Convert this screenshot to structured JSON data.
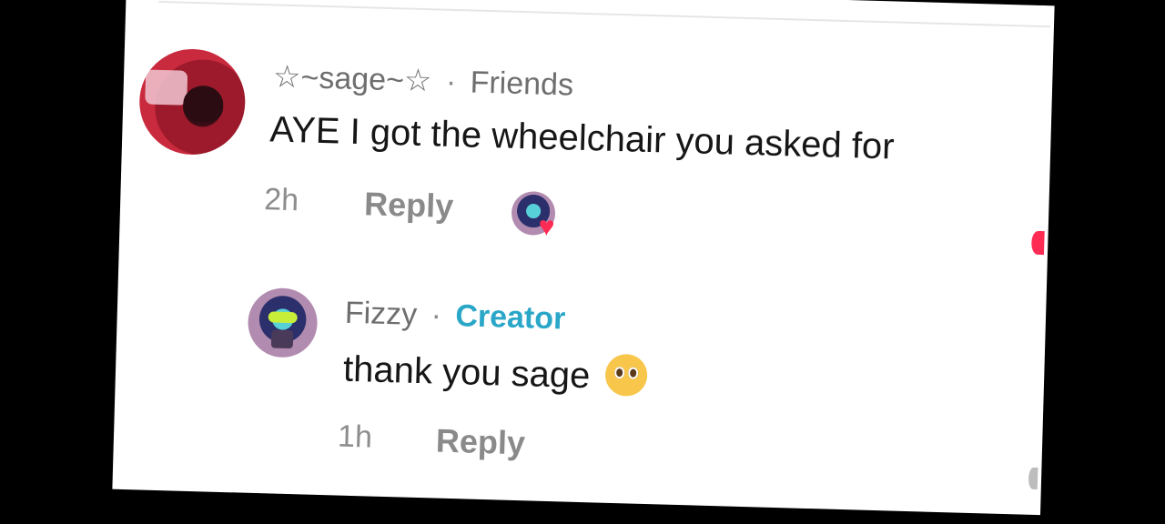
{
  "comments": [
    {
      "author": "☆~sage~☆",
      "relation": "Friends",
      "text": "AYE I got the wheelchair you asked for",
      "time": "2h",
      "reply_label": "Reply"
    },
    {
      "author": "Fizzy",
      "relation": "Creator",
      "text": "thank you sage",
      "time": "1h",
      "reply_label": "Reply"
    }
  ],
  "separator": "·",
  "icons": {
    "liked_by_creator": "heart-icon",
    "emoji": "pleading-face-emoji"
  },
  "colors": {
    "creator_badge": "#2aa7c8",
    "heart": "#fe2c55",
    "background": "#000000"
  }
}
